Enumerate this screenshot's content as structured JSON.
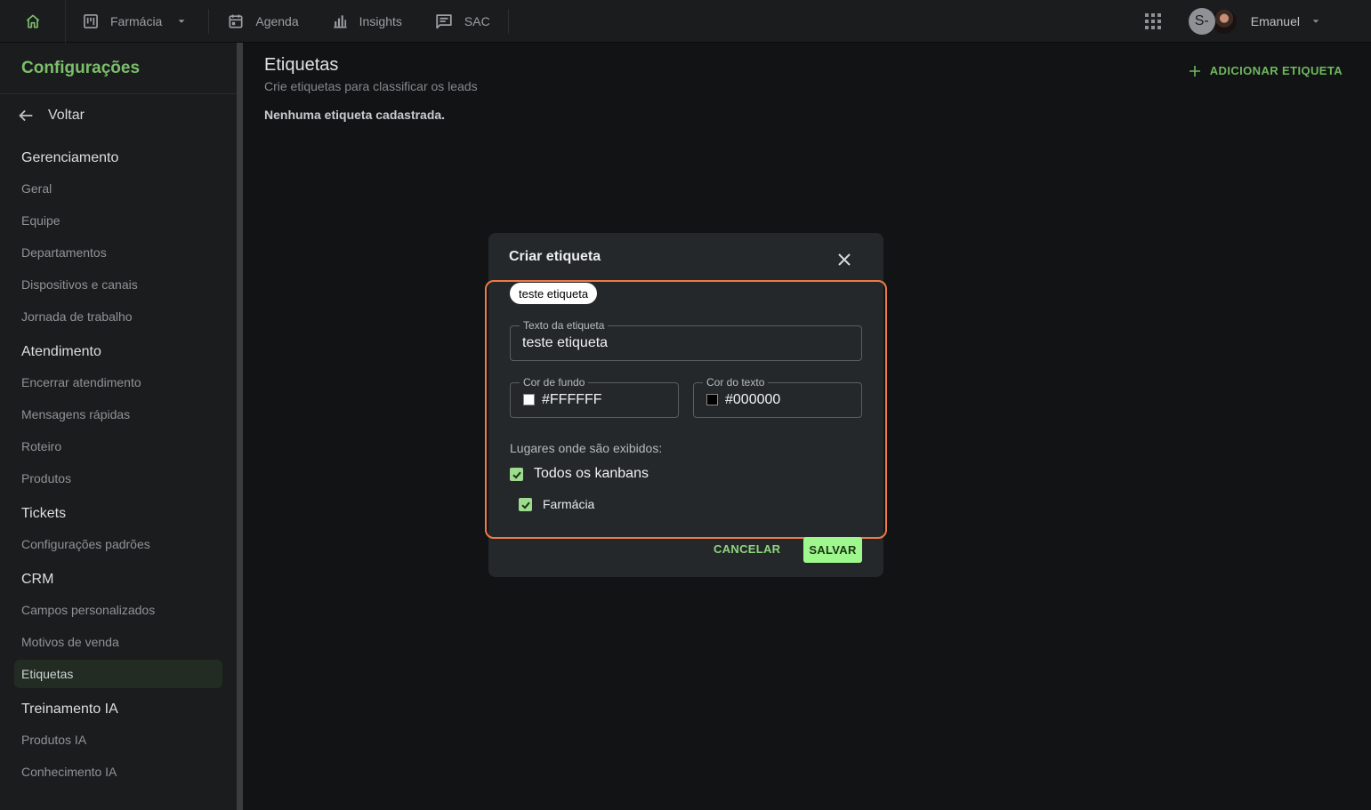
{
  "topbar": {
    "home_icon": "home-icon",
    "nav": [
      {
        "label": "Farmácia",
        "icon": "kanban-board-icon"
      },
      {
        "label": "Agenda",
        "icon": "calendar-icon"
      },
      {
        "label": "Insights",
        "icon": "bar-chart-icon"
      },
      {
        "label": "SAC",
        "icon": "chat-icon"
      }
    ],
    "avatar_initial": "S-",
    "user_name": "Emanuel"
  },
  "sidebar": {
    "title": "Configurações",
    "back_label": "Voltar",
    "sections": [
      {
        "title": "Gerenciamento",
        "items": [
          "Geral",
          "Equipe",
          "Departamentos",
          "Dispositivos e canais",
          "Jornada de trabalho"
        ]
      },
      {
        "title": "Atendimento",
        "items": [
          "Encerrar atendimento",
          "Mensagens rápidas",
          "Roteiro",
          "Produtos"
        ]
      },
      {
        "title": "Tickets",
        "items": [
          "Configurações padrões"
        ]
      },
      {
        "title": "CRM",
        "items": [
          "Campos personalizados",
          "Motivos de venda",
          "Etiquetas"
        ]
      },
      {
        "title": "Treinamento IA",
        "items": [
          "Produtos IA",
          "Conhecimento IA"
        ]
      }
    ],
    "active_item": "Etiquetas"
  },
  "main": {
    "title": "Etiquetas",
    "subtitle": "Crie etiquetas para classificar os leads",
    "empty_message": "Nenhuma etiqueta cadastrada.",
    "add_button": "ADICIONAR ETIQUETA"
  },
  "modal": {
    "title": "Criar etiqueta",
    "preview_chip": "teste etiqueta",
    "text_field": {
      "label": "Texto da etiqueta",
      "value": "teste etiqueta"
    },
    "bg_color_field": {
      "label": "Cor de fundo",
      "value": "#FFFFFF"
    },
    "text_color_field": {
      "label": "Cor do texto",
      "value": "#000000"
    },
    "places_label": "Lugares onde são exibidos:",
    "checkbox_all": {
      "label": "Todos os kanbans",
      "checked": true
    },
    "checkbox_farmacia": {
      "label": "Farmácia",
      "checked": true
    },
    "cancel_button": "CANCELAR",
    "save_button": "SALVAR"
  },
  "colors": {
    "accent_green": "#7bbf6a",
    "save_button_bg": "#9ef78d",
    "highlight_border": "#f07a45",
    "background": "#121314",
    "panel": "#1b1c1d",
    "modal": "#24282a"
  }
}
